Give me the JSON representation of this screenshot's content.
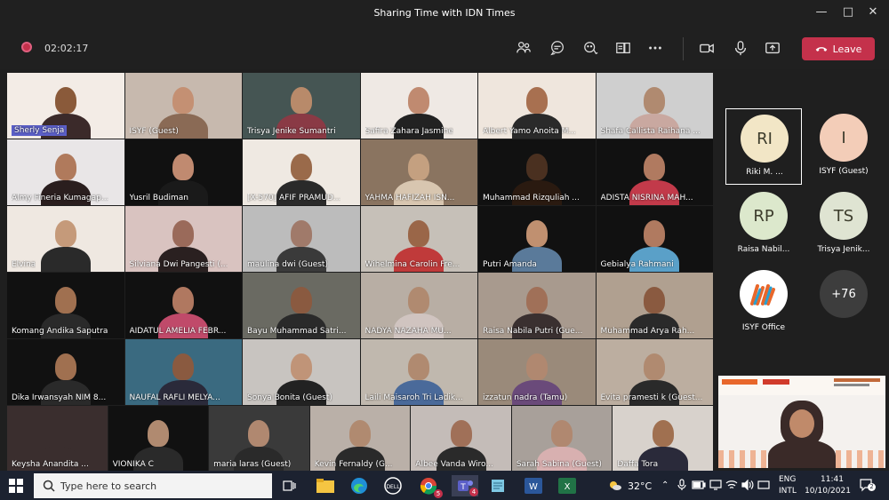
{
  "window": {
    "title": "Sharing Time with IDN Times"
  },
  "toolbar": {
    "timer": "02:02:17",
    "leave_label": "Leave"
  },
  "grid": [
    [
      {
        "name": "Sherly Senja",
        "hl": true,
        "bg": "#f3ece6",
        "face": "#8a5a3a",
        "body": "#3b2a2a"
      },
      {
        "name": "ISYF (Guest)",
        "bg": "#c7b9ae",
        "face": "#c49073",
        "body": "#8a6a55"
      },
      {
        "name": "Trisya Jenike Sumantri",
        "bg": "#455553",
        "face": "#b88a6a",
        "body": "#8a3a45"
      },
      {
        "name": "Safira Zahara Jasmine",
        "bg": "#efe9e4",
        "face": "#c08a70",
        "body": "#222"
      },
      {
        "name": "Albert Yamo Anoita M...",
        "bg": "#efe6dd",
        "face": "#a87050",
        "body": "#2a2a2a"
      },
      {
        "name": "Shafa Callista Raihana ...",
        "bg": "#cfcfcf",
        "face": "#b08a70",
        "body": "#c9a8a0"
      }
    ],
    [
      {
        "name": "Almy Fineria Kumagap...",
        "bg": "#e9e6e7",
        "face": "#b07a5c",
        "body": "#2a1e1e"
      },
      {
        "name": "Yusril Budiman",
        "bg": "#111",
        "face": "#c08a70",
        "body": "#1a1a1a"
      },
      {
        "name": "[X-570] AFIF PRAMUD...",
        "bg": "#efe9e2",
        "face": "#9a6a4a",
        "body": "#2a2a2a"
      },
      {
        "name": "YAHMA HAFIZAH ISN...",
        "bg": "#8a7460",
        "face": "#c4a080",
        "body": "#d8c6b0"
      },
      {
        "name": "Muhammad Rizquliah ...",
        "bg": "#111",
        "face": "#4a3020",
        "body": "#2a1a10"
      },
      {
        "name": "ADISTA NISRINA MAH...",
        "bg": "#111",
        "face": "#b07a60",
        "body": "#c23a4a"
      }
    ],
    [
      {
        "name": "Elvina",
        "bg": "#efe8e1",
        "face": "#c59a7a",
        "body": "#2a2a2a"
      },
      {
        "name": "Silviana Dwi Pangesti (...",
        "bg": "#d9c3c0",
        "face": "#9a6a5a",
        "body": "#2a2020"
      },
      {
        "name": "maulina dwi (Guest)",
        "bg": "#bcbcbc",
        "face": "#a07a6a",
        "body": "#3a3a3a"
      },
      {
        "name": "Wihelmina Carolin Fre...",
        "bg": "#c6c0b8",
        "face": "#9a6648",
        "body": "#c03a3a"
      },
      {
        "name": "Putri Amanda",
        "bg": "#111",
        "face": "#c09070",
        "body": "#5a7a9a"
      },
      {
        "name": "Gebialya Rahmani",
        "bg": "#111",
        "face": "#b07a60",
        "body": "#5aa0c8"
      }
    ],
    [
      {
        "name": "Komang Andika Saputra",
        "bg": "#111",
        "face": "#a07050",
        "body": "#2a2a2a"
      },
      {
        "name": "AIDATUL AMELIA FEBR...",
        "bg": "#111",
        "face": "#b07860",
        "body": "#c04a6a"
      },
      {
        "name": "Bayu Muhammad Satri...",
        "bg": "#6a6a62",
        "face": "#8a5a40",
        "body": "#2a2a2a"
      },
      {
        "name": "NADYA NAZAHA MU...",
        "bg": "#b8aea4",
        "face": "#b08a70",
        "body": "#d0c4c0"
      },
      {
        "name": "Raisa Nabila Putri (Gue...",
        "bg": "#a89a8e",
        "face": "#a07058",
        "body": "#3a3030"
      },
      {
        "name": "Muhammad Arya Rah...",
        "bg": "#b0a090",
        "face": "#8a5a40",
        "body": "#2a2a2a"
      }
    ],
    [
      {
        "name": "Dika Irwansyah NIM 8...",
        "bg": "#111",
        "face": "#a07050",
        "body": "#2a2a2a"
      },
      {
        "name": "NAUFAL RAFLI MELYA...",
        "bg": "#3a6a80",
        "face": "#8a5a40",
        "body": "#2a2a3a"
      },
      {
        "name": "Sonya Bonita (Guest)",
        "bg": "#c8c4c0",
        "face": "#c09478",
        "body": "#222"
      },
      {
        "name": "Laili Maisaroh Tri Ladik...",
        "bg": "#c0b8ae",
        "face": "#b08a70",
        "body": "#4a6a9a"
      },
      {
        "name": "izzatun nadra (Tamu)",
        "bg": "#9a8a7a",
        "face": "#b08870",
        "body": "#6a4a7a"
      },
      {
        "name": "Evita pramesti k (Guest...",
        "bg": "#bcaea0",
        "face": "#b08a70",
        "body": "#2a2a2a"
      }
    ],
    [
      {
        "name": "Keysha Anandita ...",
        "bg": "#3a2e2e",
        "face": "#3a2e2e",
        "body": "#3a2e2e"
      },
      {
        "name": "VIONIKA C",
        "bg": "#111",
        "face": "#b08a70",
        "body": "#2a2a2a"
      },
      {
        "name": "maria laras (Guest)",
        "bg": "#3a3a3a",
        "face": "#b08870",
        "body": "#2a2a2a"
      },
      {
        "name": "Kevin Fernaldy (G...",
        "bg": "#bab0a8",
        "face": "#b08a70",
        "body": "#2a2a2a"
      },
      {
        "name": "Albee Vanda Wiro...",
        "bg": "#c4bcb8",
        "face": "#a07058",
        "body": "#2a2a2a"
      },
      {
        "name": "Sarah Sabina (Guest)",
        "bg": "#a8a09a",
        "face": "#b08870",
        "body": "#d8b0b0"
      },
      {
        "name": "Daffa Tora",
        "bg": "#d8d2cc",
        "face": "#a07050",
        "body": "#2a2a3a"
      }
    ]
  ],
  "side": [
    {
      "initials": "RI",
      "name": "Riki M. ...",
      "bg": "#f2e6c6",
      "selected": true
    },
    {
      "initials": "I",
      "name": "ISYF (Guest)",
      "bg": "#f3cdb8"
    },
    {
      "initials": "RP",
      "name": "Raisa Nabil...",
      "bg": "#dce8cc"
    },
    {
      "initials": "TS",
      "name": "Trisya Jenik...",
      "bg": "#dfe4d2"
    },
    {
      "initials": "",
      "name": "ISYF Office",
      "bg": "#ffffff",
      "logo": true
    },
    {
      "initials": "+76",
      "name": "",
      "bg": "#3d3d3d",
      "more": true
    }
  ],
  "taskbar": {
    "search_placeholder": "Type here to search",
    "temperature": "32°C",
    "lang1": "ENG",
    "lang2": "INTL",
    "time": "11:41",
    "date": "10/10/2021",
    "notif_count": "2",
    "teams_badge": "4",
    "chrome_badge": "5"
  },
  "colors": {
    "accent": "#5b5fc7",
    "leave": "#c4314b",
    "taskbar": "#1c2230"
  }
}
